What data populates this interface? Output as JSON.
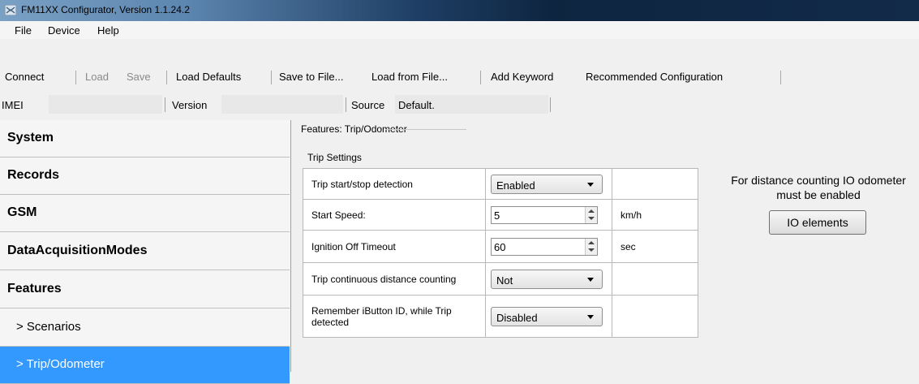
{
  "window": {
    "title": "FM11XX Configurator, Version 1.1.24.2",
    "icon": "app-icon"
  },
  "menu": [
    "File",
    "Device",
    "Help"
  ],
  "toolbar": {
    "connect": "Connect",
    "load": "Load",
    "save": "Save",
    "load_defaults": "Load Defaults",
    "save_to_file": "Save to File...",
    "load_from_file": "Load from File...",
    "add_keyword": "Add Keyword",
    "recommended": "Recommended Configuration"
  },
  "info": {
    "imei_label": "IMEI",
    "imei_value": "",
    "version_label": "Version",
    "version_value": "",
    "source_label": "Source",
    "source_value": "Default."
  },
  "sidebar": {
    "items": [
      "System",
      "Records",
      "GSM",
      "DataAcquisitionModes",
      "Features"
    ],
    "subitems": [
      "> Scenarios",
      "> Trip/Odometer"
    ],
    "selected": "> Trip/Odometer"
  },
  "main": {
    "group_title": "Features: Trip/Odometer",
    "section_title": "Trip Settings",
    "rows": [
      {
        "label": "Trip start/stop detection",
        "type": "combo",
        "value": "Enabled",
        "unit": ""
      },
      {
        "label": "Start Speed:",
        "type": "spin",
        "value": "5",
        "unit": "km/h"
      },
      {
        "label": "Ignition Off Timeout",
        "type": "spin",
        "value": "60",
        "unit": "sec"
      },
      {
        "label": "Trip continuous distance counting",
        "type": "combo",
        "value": "Not",
        "unit": ""
      },
      {
        "label": "Remember iButton ID, while Trip detected",
        "type": "combo",
        "value": "Disabled",
        "unit": ""
      }
    ],
    "note": "For distance counting IO odometer must be enabled",
    "io_button": "IO elements"
  },
  "colors": {
    "selection": "#3399ff",
    "titlebar_dark": "#0e2540"
  }
}
